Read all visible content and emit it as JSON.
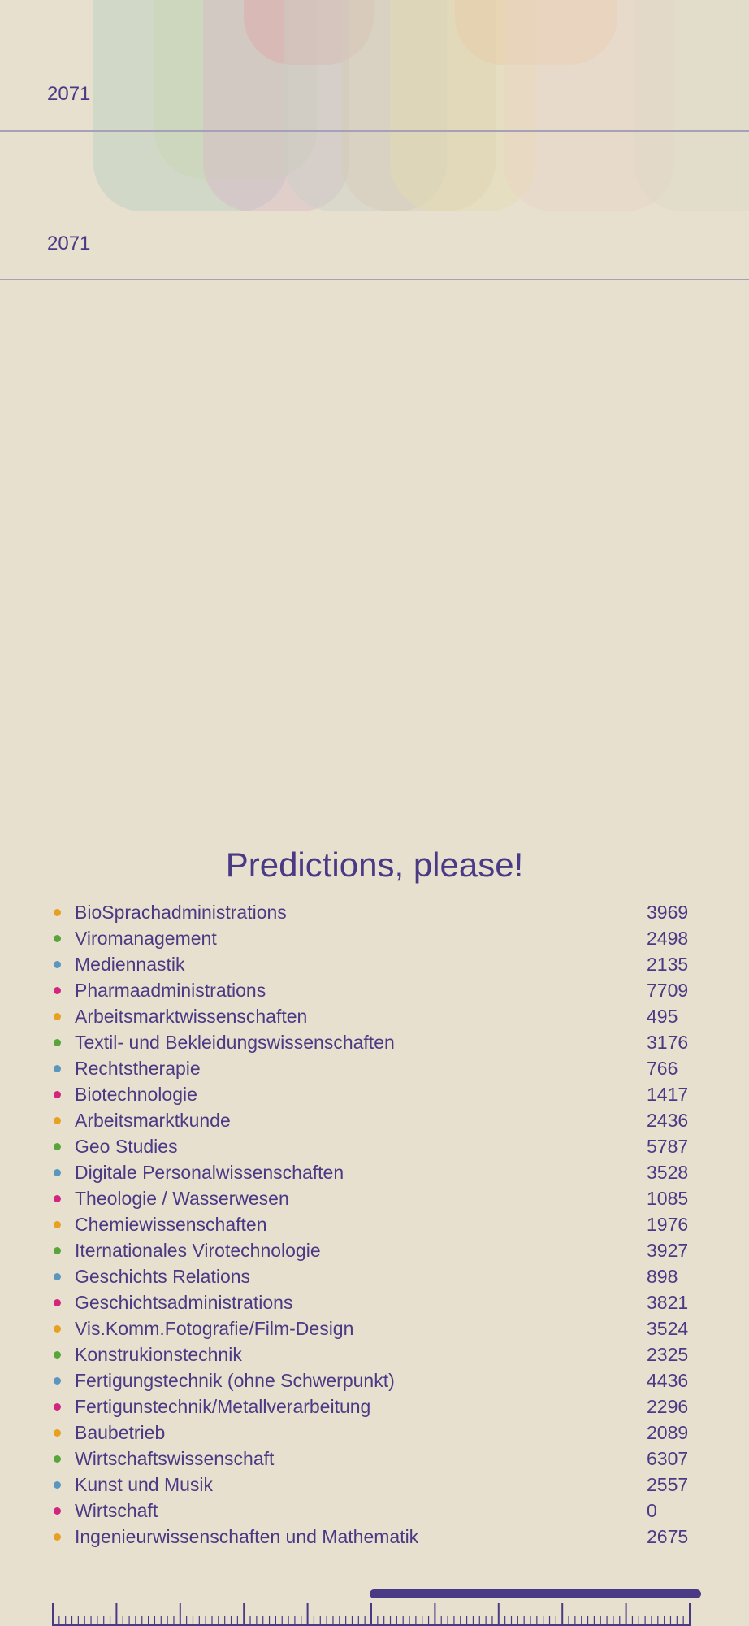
{
  "timeline": {
    "year_labels": [
      "2071",
      "2071"
    ]
  },
  "predictions": {
    "title": "Predictions, please!",
    "colors": [
      "#e8a020",
      "#58a63a",
      "#5b96c0",
      "#d2257f"
    ],
    "items": [
      {
        "label": "BioSprachadministrations",
        "value": "3969"
      },
      {
        "label": "Viromanagement",
        "value": "2498"
      },
      {
        "label": "Mediennastik",
        "value": "2135"
      },
      {
        "label": "Pharmaadministrations",
        "value": "7709"
      },
      {
        "label": "Arbeitsmarktwissenschaften",
        "value": "495"
      },
      {
        "label": "Textil- und Bekleidungswissenschaften",
        "value": "3176"
      },
      {
        "label": "Rechtstherapie",
        "value": "766"
      },
      {
        "label": "Biotechnologie",
        "value": "1417"
      },
      {
        "label": "Arbeitsmarktkunde",
        "value": "2436"
      },
      {
        "label": "Geo Studies",
        "value": "5787"
      },
      {
        "label": "Digitale Personalwissenschaften",
        "value": "3528"
      },
      {
        "label": "Theologie / Wasserwesen",
        "value": "1085"
      },
      {
        "label": "Chemiewissenschaften",
        "value": "1976"
      },
      {
        "label": "Iternationales Virotechnologie",
        "value": "3927"
      },
      {
        "label": "Geschichts Relations",
        "value": "898"
      },
      {
        "label": "Geschichtsadministrations",
        "value": "3821"
      },
      {
        "label": "Vis.Komm.Fotografie/Film-Design",
        "value": "3524"
      },
      {
        "label": "Konstrukionstechnik",
        "value": "2325"
      },
      {
        "label": "Fertigungstechnik (ohne Schwerpunkt)",
        "value": "4436"
      },
      {
        "label": "Fertigunstechnik/Metallverarbeitung",
        "value": "2296"
      },
      {
        "label": "Baubetrieb",
        "value": "2089"
      },
      {
        "label": "Wirtschaftswissenschaft",
        "value": "6307"
      },
      {
        "label": "Kunst und Musik",
        "value": "2557"
      },
      {
        "label": "Wirtschaft",
        "value": "0"
      },
      {
        "label": "Ingenieurwissenschaften und Mathematik",
        "value": "2675"
      }
    ]
  },
  "slider": {
    "progress_fraction": 0.5,
    "accent": "#4a3a85"
  }
}
